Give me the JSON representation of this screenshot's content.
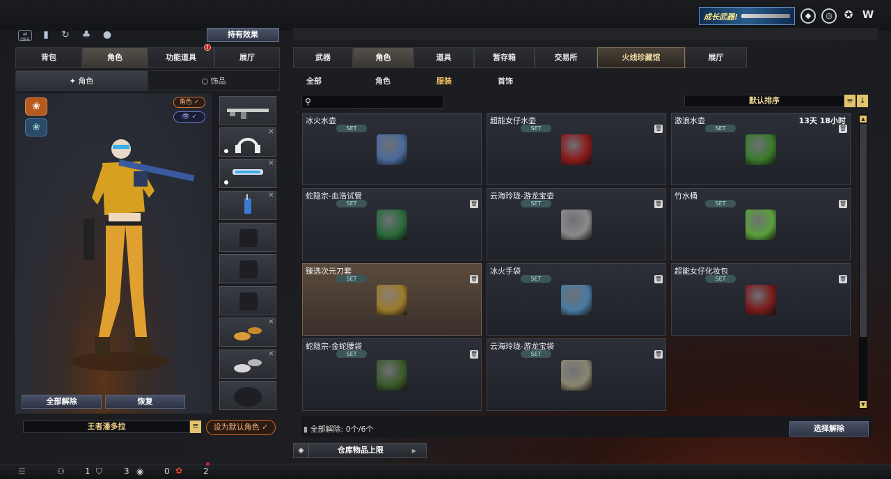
{
  "top": {
    "promo_text": "成长武器!"
  },
  "left_icons": {
    "toggle_label": "OFF"
  },
  "hold_effect_label": "持有效果",
  "left_tabs": [
    {
      "label": "背包"
    },
    {
      "label": "角色"
    },
    {
      "label": "功能道具"
    },
    {
      "label": "展厅"
    }
  ],
  "left_alert": "!",
  "left_subtabs": [
    {
      "label": "角色"
    },
    {
      "label": "饰品"
    }
  ],
  "character": {
    "role_badge": "角色 ✓",
    "view_badge": "👁 ✓",
    "unequip_all": "全部解除",
    "restore": "恢复",
    "name": "王者潘多拉",
    "set_default": "设为默认角色 ✓"
  },
  "right_tabs": [
    {
      "label": "武器"
    },
    {
      "label": "角色"
    },
    {
      "label": "道具"
    },
    {
      "label": "暂存箱"
    },
    {
      "label": "交易所"
    },
    {
      "label": "火线珍藏馆"
    },
    {
      "label": "展厅"
    }
  ],
  "right_subtabs": [
    {
      "label": "全部"
    },
    {
      "label": "角色"
    },
    {
      "label": "服装"
    },
    {
      "label": "首饰"
    }
  ],
  "search": {
    "placeholder": ""
  },
  "sort_label": "默认排序",
  "set_label": "SET",
  "items": [
    {
      "name": "冰火水壶",
      "time": "",
      "color": "#4a6a9a"
    },
    {
      "name": "超能女仔水壶",
      "time": "",
      "color": "#8a1a1a"
    },
    {
      "name": "激浪水壶",
      "time": "13天 18小时",
      "color": "#3a7a2a"
    },
    {
      "name": "蛇隐宗-血浩试管",
      "time": "",
      "color": "#2a6a3a"
    },
    {
      "name": "云海玲珑-游龙宝壶",
      "time": "",
      "color": "#8a8a8a"
    },
    {
      "name": "竹水桶",
      "time": "",
      "color": "#5aa03a"
    },
    {
      "name": "臻选次元刀套",
      "time": "",
      "color": "#9a7a2a"
    },
    {
      "name": "冰火手袋",
      "time": "",
      "color": "#4a7aa0"
    },
    {
      "name": "超能女仔化妆包",
      "time": "",
      "color": "#7a1a1a"
    },
    {
      "name": "蛇隐宗-金蛇腰袋",
      "time": "",
      "color": "#3a5a2a"
    },
    {
      "name": "云海玲珑-游龙宝袋",
      "time": "",
      "color": "#8a8570"
    }
  ],
  "footer": {
    "unequip_text": "全部解除: 0个/6个",
    "select_unequip": "选择解除",
    "storage_limit": "仓库物品上限"
  },
  "status": {
    "count_1": "1",
    "count_2": "3",
    "count_3": "0",
    "count_4": "2"
  }
}
